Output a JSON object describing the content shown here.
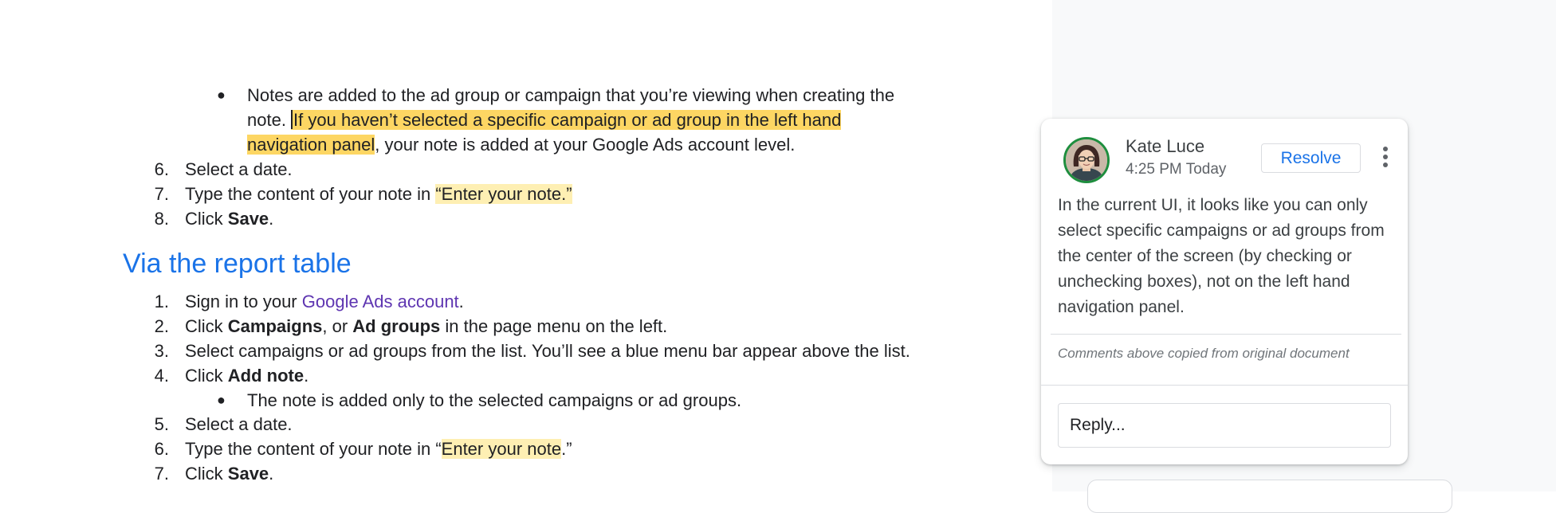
{
  "doc": {
    "top_bullet": {
      "line1": "Notes are added to the ad group or campaign that you’re viewing when creating the",
      "line2_start": "note. ",
      "line2_highlight": "If you haven’t selected a specific campaign or ad group in the left hand",
      "line3_highlight": "navigation panel",
      "line3_rest": ", your note is added at your Google Ads account level."
    },
    "list1": [
      {
        "num": "6.",
        "text": "Select a date."
      },
      {
        "num": "7.",
        "before": "Type the content of your note in ",
        "highlight": "“Enter your note.”"
      },
      {
        "num": "8.",
        "before": "Click ",
        "bold": "Save",
        "after": "."
      }
    ],
    "heading": "Via the report table",
    "list2": [
      {
        "num": "1.",
        "before": "Sign in to your ",
        "link": "Google Ads account",
        "after": "."
      },
      {
        "num": "2.",
        "before": "Click ",
        "bold1": "Campaigns",
        "mid": ", or ",
        "bold2": "Ad groups",
        "after": " in the page menu on the left."
      },
      {
        "num": "3.",
        "text": "Select campaigns or ad groups from the list. You’ll see a blue menu bar appear above the list."
      },
      {
        "num": "4.",
        "before": "Click ",
        "bold": "Add note",
        "after": "."
      },
      {
        "num": "5.",
        "text": "Select a date."
      },
      {
        "num": "6.",
        "before": "Type the content of your note in “",
        "highlight": "Enter your note",
        "after": ".”"
      },
      {
        "num": "7.",
        "before": "Click ",
        "bold": "Save",
        "after": "."
      }
    ],
    "sub_bullet": "The note is added only to the selected campaigns or ad groups.",
    "bullet_glyph": "●"
  },
  "comment": {
    "author": "Kate Luce",
    "time": "4:25 PM Today",
    "resolve_label": "Resolve",
    "body": "In the current UI, it looks like you can only select specific campaigns or ad groups from the center of the screen (by checking or unchecking boxes), not on the left hand navigation panel.",
    "copied_note": "Comments above copied from original document",
    "reply_placeholder": "Reply...",
    "avatar_icon": "user-avatar-icon",
    "more_icon": "more-vert-icon"
  },
  "colors": {
    "heading": "#1a73e8",
    "link": "#5e35b1",
    "highlight_strong": "#fdd663",
    "highlight_light": "#feefb3",
    "resolve": "#1a73e8",
    "avatar_ring": "#1e8e3e",
    "side_panel": "#f8f9fa"
  }
}
